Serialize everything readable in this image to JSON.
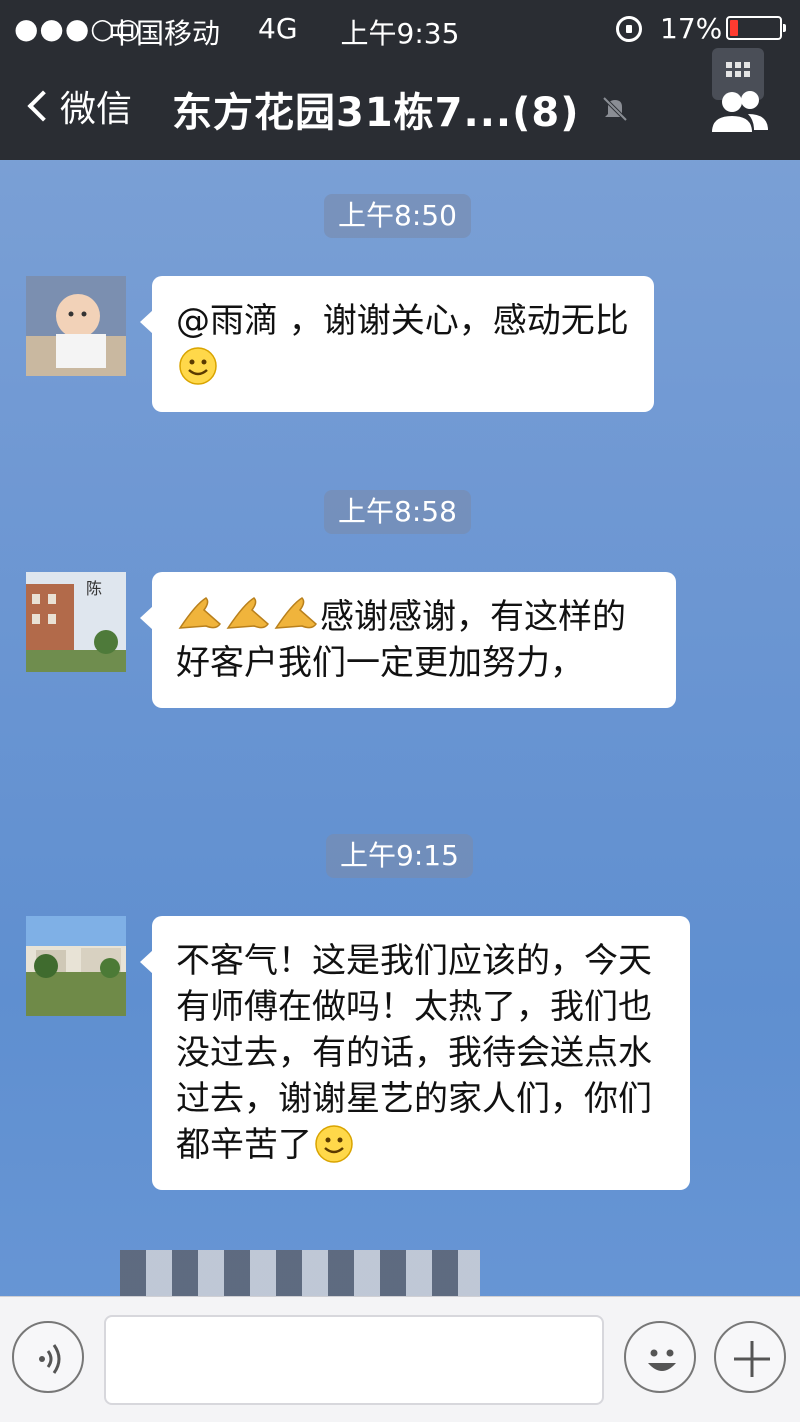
{
  "status_bar": {
    "signal": "●●●○○",
    "carrier": "中国移动",
    "network": "4G",
    "time": "上午9:35",
    "battery_percent_text": "17%",
    "battery_level": 0.17,
    "battery_color": "#ff3b30"
  },
  "nav": {
    "back_label": "微信",
    "title": "东方花园31栋7...(8)",
    "muted_icon": "mute-bell-icon",
    "group_icon": "group-members-icon",
    "bg_color": "#2a2d33"
  },
  "messages": [
    {
      "timestamp": "上午8:50",
      "avatar": "child-photo-avatar",
      "text": "@雨滴 ，谢谢关心，感动无比",
      "trailing_emoji": "smile-emoji"
    },
    {
      "timestamp": "上午8:58",
      "avatar": "building-photo-avatar",
      "leading_emoji": [
        "clapping-hands-emoji",
        "clapping-hands-emoji",
        "clapping-hands-emoji"
      ],
      "text": "感谢感谢，有这样的好客户我们一定更加努力，"
    },
    {
      "timestamp": "上午9:15",
      "avatar": "landscape-photo-avatar",
      "text": "不客气！这是我们应该的，今天有师傅在做吗！太热了，我们也没过去，有的话，我待会送点水过去，谢谢星艺的家人们，你们都辛苦了",
      "trailing_emoji": "smile-emoji"
    }
  ],
  "input_bar": {
    "voice_icon": "voice-input-icon",
    "emoji_icon": "emoji-icon",
    "more_icon": "plus-icon",
    "input_value": ""
  }
}
